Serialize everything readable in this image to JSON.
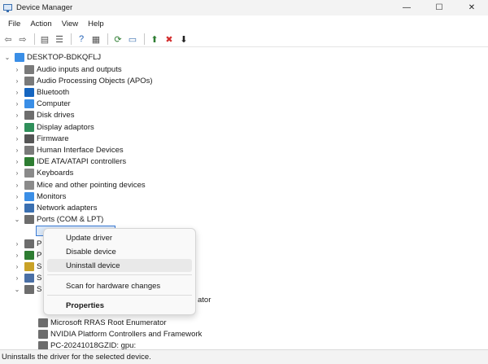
{
  "window": {
    "title": "Device Manager",
    "minimize": "—",
    "maximize": "☐",
    "close": "✕"
  },
  "menu": [
    "File",
    "Action",
    "View",
    "Help"
  ],
  "toolbar": [
    {
      "name": "back-icon",
      "glyph": "⇦",
      "color": "#5a5a5a"
    },
    {
      "name": "forward-icon",
      "glyph": "⇨",
      "color": "#5a5a5a"
    },
    {
      "name": "properties-icon",
      "glyph": "▤",
      "color": "#555555"
    },
    {
      "name": "list-view-icon",
      "glyph": "☰",
      "color": "#555555"
    },
    {
      "name": "help-icon",
      "glyph": "?",
      "color": "#1f5fb5"
    },
    {
      "name": "device-view-icon",
      "glyph": "▦",
      "color": "#555555"
    },
    {
      "name": "scan-hardware-icon",
      "glyph": "⟳",
      "color": "#2e7d32"
    },
    {
      "name": "monitor-icon",
      "glyph": "▭",
      "color": "#3a6fb0"
    },
    {
      "name": "add-driver-icon",
      "glyph": "⬆",
      "color": "#2e7d32"
    },
    {
      "name": "uninstall-icon",
      "glyph": "✖",
      "color": "#d32f2f"
    },
    {
      "name": "download-icon",
      "glyph": "⬇",
      "color": "#222222"
    }
  ],
  "tree": {
    "root": "DESKTOP-BDKQFLJ",
    "items": [
      {
        "label": "Audio inputs and outputs",
        "icon": "speaker-icon",
        "color": "#7a7a7a",
        "expanded": false
      },
      {
        "label": "Audio Processing Objects (APOs)",
        "icon": "speaker-icon",
        "color": "#7a7a7a",
        "expanded": false
      },
      {
        "label": "Bluetooth",
        "icon": "bluetooth-icon",
        "color": "#1565c0",
        "expanded": false
      },
      {
        "label": "Computer",
        "icon": "computer-icon",
        "color": "#3a8ee6",
        "expanded": false
      },
      {
        "label": "Disk drives",
        "icon": "disk-icon",
        "color": "#6d6d6d",
        "expanded": false
      },
      {
        "label": "Display adaptors",
        "icon": "display-icon",
        "color": "#2f8f5a",
        "expanded": false
      },
      {
        "label": "Firmware",
        "icon": "chip-icon",
        "color": "#555555",
        "expanded": false
      },
      {
        "label": "Human Interface Devices",
        "icon": "hid-icon",
        "color": "#7a7a7a",
        "expanded": false
      },
      {
        "label": "IDE ATA/ATAPI controllers",
        "icon": "controller-icon",
        "color": "#2e7d32",
        "expanded": false
      },
      {
        "label": "Keyboards",
        "icon": "keyboard-icon",
        "color": "#8a8a8a",
        "expanded": false
      },
      {
        "label": "Mice and other pointing devices",
        "icon": "mouse-icon",
        "color": "#8a8a8a",
        "expanded": false
      },
      {
        "label": "Monitors",
        "icon": "monitor-icon",
        "color": "#3a8ee6",
        "expanded": false
      },
      {
        "label": "Network adapters",
        "icon": "network-icon",
        "color": "#3a6fb0",
        "expanded": false
      },
      {
        "label": "Ports (COM & LPT)",
        "icon": "port-icon",
        "color": "#6d6d6d",
        "expanded": true
      }
    ],
    "partial_items": [
      {
        "label": "P",
        "icon": "printer-icon",
        "color": "#6d6d6d"
      },
      {
        "label": "P",
        "icon": "processor-icon",
        "color": "#2e7d32"
      },
      {
        "label": "S",
        "icon": "security-icon",
        "color": "#c9a227"
      },
      {
        "label": "S",
        "icon": "software-icon",
        "color": "#4a6fa5"
      },
      {
        "label": "S",
        "icon": "system-icon",
        "color": "#6d6d6d"
      }
    ],
    "system_children": [
      {
        "label": "Microsoft RRAS Root Enumerator",
        "icon": "system-device-icon",
        "color": "#6d6d6d"
      },
      {
        "label": "NVIDIA Platform Controllers and Framework",
        "icon": "system-device-icon",
        "color": "#6d6d6d"
      },
      {
        "label": "PC-20241018GZID: gpu:",
        "icon": "system-device-icon",
        "color": "#6d6d6d"
      }
    ],
    "partial_text_right": "ator"
  },
  "context_menu": {
    "update": "Update driver",
    "disable": "Disable device",
    "uninstall": "Uninstall device",
    "scan": "Scan for hardware changes",
    "properties": "Properties"
  },
  "status": "Uninstalls the driver for the selected device."
}
